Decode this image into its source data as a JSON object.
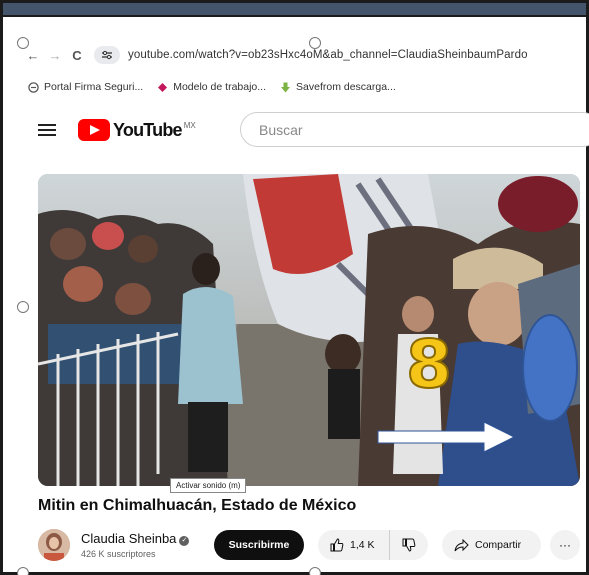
{
  "browser": {
    "nav": {
      "back": "←",
      "forward": "→",
      "reload": "C"
    },
    "tune_icon": "site-settings-icon",
    "url": "youtube.com/watch?v=ob23sHxc4oM&ab_channel=ClaudiaSheinbaumPardo"
  },
  "bookmarks": [
    {
      "label": "Portal Firma Seguri...",
      "icon": "portal-icon",
      "color": "#555555"
    },
    {
      "label": "Modelo de trabajo...",
      "icon": "diamond-icon",
      "color": "#c2185b"
    },
    {
      "label": "Savefrom descarga...",
      "icon": "download-arrow-icon",
      "color": "#7cb342"
    }
  ],
  "youtube": {
    "logo_text": "YouTube",
    "country": "MX",
    "search_placeholder": "Buscar"
  },
  "video": {
    "overlay_number": "8",
    "overlay_number_color": "#f5c518",
    "marker_color": "#4472c4",
    "tooltip": "Activar sonido (m)"
  },
  "title": "Mitin en Chimalhuacán, Estado de México",
  "channel": {
    "name": "Claudia Sheinba",
    "subscribers": "426 K suscriptores",
    "subscribe_label": "Suscribirme"
  },
  "actions": {
    "likes": "1,4 K",
    "share_label": "Compartir",
    "more": "···"
  }
}
